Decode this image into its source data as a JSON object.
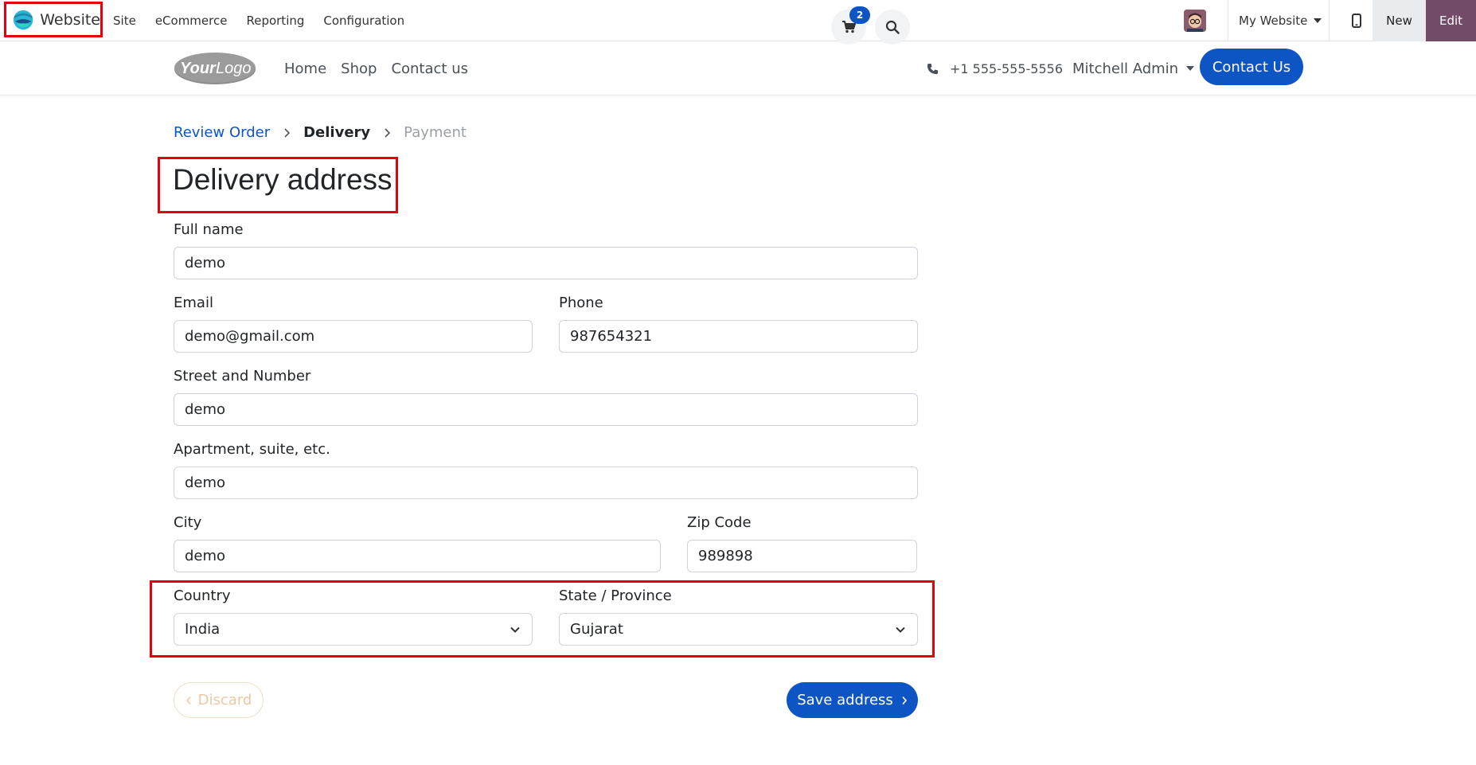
{
  "adminbar": {
    "app_name": "Website",
    "menu": [
      "Site",
      "eCommerce",
      "Reporting",
      "Configuration"
    ],
    "website_selector": "My Website",
    "new_label": "New",
    "edit_label": "Edit"
  },
  "header": {
    "logo_text": "YourLogo",
    "nav": [
      "Home",
      "Shop",
      "Contact us"
    ],
    "cart_count": "2",
    "phone": "+1 555-555-5556",
    "user": "Mitchell Admin",
    "contact_button": "Contact Us"
  },
  "breadcrumb": {
    "step1": "Review Order",
    "step2": "Delivery",
    "step3": "Payment"
  },
  "form": {
    "title": "Delivery address",
    "full_name": {
      "label": "Full name",
      "value": "demo"
    },
    "email": {
      "label": "Email",
      "value": "demo@gmail.com"
    },
    "phone": {
      "label": "Phone",
      "value": "987654321"
    },
    "street": {
      "label": "Street and Number",
      "value": "demo"
    },
    "apartment": {
      "label": "Apartment, suite, etc.",
      "value": "demo"
    },
    "city": {
      "label": "City",
      "value": "demo"
    },
    "zip": {
      "label": "Zip Code",
      "value": "989898"
    },
    "country": {
      "label": "Country",
      "value": "India"
    },
    "state": {
      "label": "State / Province",
      "value": "Gujarat"
    },
    "discard_label": "Discard",
    "save_label": "Save address"
  },
  "colors": {
    "primary": "#0d54c4",
    "edit_bg": "#714b67",
    "highlight": "#e3000f"
  }
}
